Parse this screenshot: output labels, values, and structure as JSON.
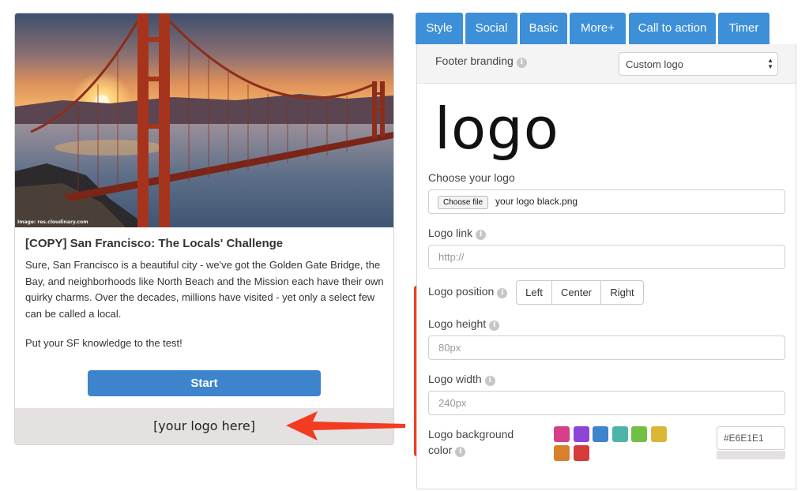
{
  "preview": {
    "image_credit": "Image: res.cloudinary.com",
    "title": "[COPY] San Francisco: The Locals' Challenge",
    "description": "Sure, San Francisco is a beautiful city - we've got the Golden Gate Bridge, the Bay, and neighborhoods like North Beach and the Mission each have their own quirky charms. Over the decades, millions have visited - yet only a select few can be called a local.",
    "call_to_action": "Put your SF knowledge to the test!",
    "start_label": "Start",
    "footer_text": "[your logo here]",
    "footer_bg": "#E6E1E1"
  },
  "tabs": [
    "Style",
    "Social",
    "Basic",
    "More+",
    "Call to action",
    "Timer"
  ],
  "settings": {
    "footer_branding_label": "Footer branding",
    "footer_branding_value": "Custom logo",
    "logo_preview_text": "logo",
    "choose_logo_label": "Choose your logo",
    "choose_file_button": "Choose file",
    "file_name": "your logo black.png",
    "logo_link_label": "Logo link",
    "logo_link_placeholder": "http://",
    "logo_position_label": "Logo position",
    "logo_position_options": [
      "Left",
      "Center",
      "Right"
    ],
    "logo_height_label": "Logo height",
    "logo_height_placeholder": "80px",
    "logo_width_label": "Logo width",
    "logo_width_placeholder": "240px",
    "logo_bg_label_line1": "Logo background",
    "logo_bg_label_line2": "color",
    "logo_bg_value": "#E6E1E1",
    "swatches": [
      "#d63f8a",
      "#8e44d9",
      "#3d84cc",
      "#4db5a8",
      "#72c043",
      "#d9b837",
      "#d9802e",
      "#d63b3b"
    ],
    "info_icon": "i"
  },
  "colors": {
    "tab": "#3d8fd8",
    "start_button": "#3d84cc",
    "annotation": "#f13c22"
  }
}
